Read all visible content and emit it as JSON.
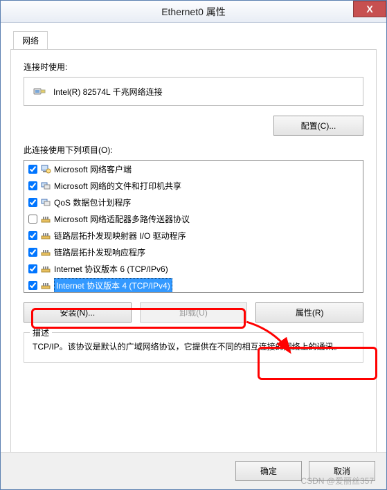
{
  "window": {
    "title": "Ethernet0 属性",
    "close_glyph": "X"
  },
  "tab": {
    "label": "网络"
  },
  "connect_using": {
    "label": "连接时使用:",
    "adapter": "Intel(R) 82574L 千兆网络连接"
  },
  "buttons": {
    "configure": "配置(C)...",
    "install": "安装(N)...",
    "uninstall": "卸载(U)",
    "properties": "属性(R)",
    "ok": "确定",
    "cancel": "取消"
  },
  "items_label": "此连接使用下列项目(O):",
  "items": [
    {
      "checked": true,
      "icon": "client",
      "label": "Microsoft 网络客户端"
    },
    {
      "checked": true,
      "icon": "service",
      "label": "Microsoft 网络的文件和打印机共享"
    },
    {
      "checked": true,
      "icon": "service",
      "label": "QoS 数据包计划程序"
    },
    {
      "checked": false,
      "icon": "protocol",
      "label": "Microsoft 网络适配器多路传送器协议"
    },
    {
      "checked": true,
      "icon": "protocol",
      "label": "链路层拓扑发现映射器 I/O 驱动程序"
    },
    {
      "checked": true,
      "icon": "protocol",
      "label": "链路层拓扑发现响应程序"
    },
    {
      "checked": true,
      "icon": "protocol",
      "label": "Internet 协议版本 6 (TCP/IPv6)"
    },
    {
      "checked": true,
      "icon": "protocol",
      "label": "Internet 协议版本 4 (TCP/IPv4)",
      "selected": true
    }
  ],
  "description": {
    "legend": "描述",
    "text": "TCP/IP。该协议是默认的广域网络协议，它提供在不同的相互连接的网络上的通讯。"
  },
  "watermark": "CSDN @爱丽丝357"
}
